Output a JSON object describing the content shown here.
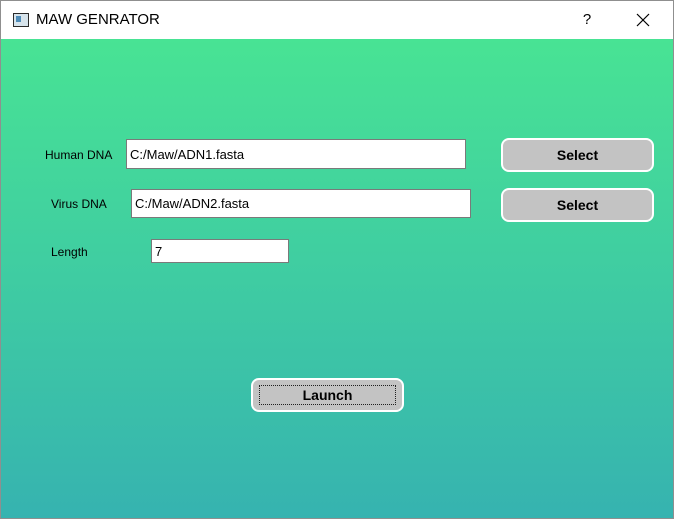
{
  "window": {
    "title": "MAW GENRATOR",
    "help_label": "?",
    "icons": {
      "app": "window-app-icon",
      "close": "close-icon"
    }
  },
  "form": {
    "human": {
      "label": "Human DNA",
      "value": "C:/Maw/ADN1.fasta",
      "button": "Select"
    },
    "virus": {
      "label": "Virus DNA",
      "value": "C:/Maw/ADN2.fasta",
      "button": "Select"
    },
    "length": {
      "label": "Length",
      "value": "7"
    },
    "launch_label": "Launch"
  },
  "colors": {
    "gradient_top": "#48e394",
    "gradient_bottom": "#36b3b0",
    "button_face": "#c3c3c3",
    "button_border": "#ffffff"
  }
}
